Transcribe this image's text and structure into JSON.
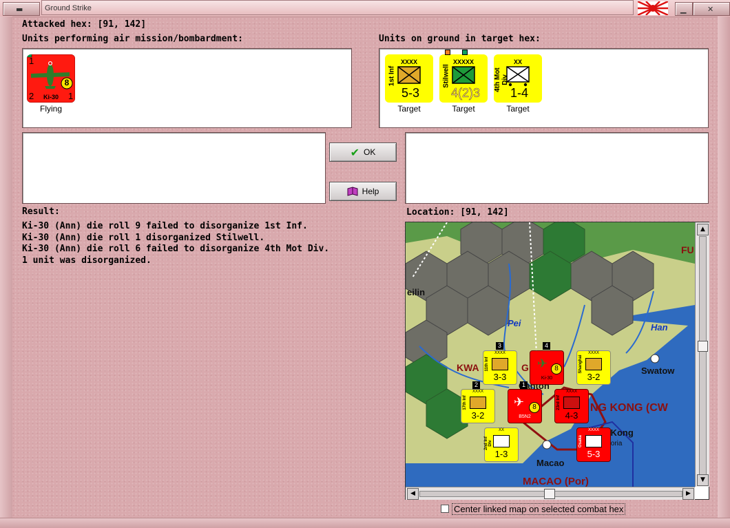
{
  "window": {
    "title": "Ground Strike"
  },
  "attacked_hex": {
    "label": "Attacked hex:",
    "value": "[91, 142]"
  },
  "air_units": {
    "heading": "Units performing air mission/bombardment:",
    "items": [
      {
        "type_label": "Ki-30",
        "top_left": "1",
        "bottom_left": "2",
        "bottom_right": "1",
        "circle": "8",
        "status": "Flying"
      }
    ]
  },
  "ground_units": {
    "heading": "Units on ground in target hex:",
    "items": [
      {
        "name": "1st Inf",
        "size": "XXXX",
        "strength": "5-3",
        "status": "Target",
        "color": "#e0a82a"
      },
      {
        "name": "Stilwell",
        "size": "XXXXX",
        "strength": "4(2)3",
        "status": "Target",
        "color": "#1e9b3a"
      },
      {
        "name": "4th Mot Div",
        "size": "XX",
        "strength": "1-4",
        "status": "Target",
        "color": "#ffffff"
      }
    ]
  },
  "buttons": {
    "ok": "OK",
    "help": "Help"
  },
  "result": {
    "heading": "Result:",
    "lines": [
      "Ki-30 (Ann) die roll 9 failed to disorganize 1st Inf.",
      "Ki-30 (Ann) die roll 1 disorganized Stilwell.",
      "Ki-30 (Ann) die roll 6 failed to disorganize 4th Mot Div.",
      "1 unit was disorganized."
    ]
  },
  "location": {
    "label": "Location:",
    "value": "[91, 142]"
  },
  "map": {
    "labels": {
      "fu": "FU",
      "guilin": "eilin",
      "pei": "Pei",
      "han": "Han",
      "kwangtung": "KWA",
      "kwangtung_tail": "G",
      "swatow": "Swatow",
      "canton": "Canton",
      "hongkong_region": "NG KONG (CW",
      "hongkong": "g Kong",
      "victoria": "ctoria",
      "macao": "Macao",
      "macao_region": "MACAO (Por)"
    },
    "hex_numbers": {
      "n3": "3",
      "n4": "4",
      "n2": "2",
      "n1": "1"
    },
    "counters": [
      {
        "name": "11th Inf",
        "size": "XXXX",
        "strength": "3-3",
        "bg": "#ffff00"
      },
      {
        "name": "Ki-30",
        "size": "",
        "strength": "8",
        "bg": "#ff0000"
      },
      {
        "name": "Shanghai",
        "size": "XXXX",
        "strength": "3-2",
        "bg": "#ffff00"
      },
      {
        "name": "17th Inf",
        "size": "XXXX",
        "strength": "3-2",
        "bg": "#ffff00"
      },
      {
        "name": "B5N2",
        "size": "",
        "strength": "8",
        "bg": "#ff0000"
      },
      {
        "name": "23rd Inf",
        "size": "XXXX",
        "strength": "4-3",
        "bg": "#ff0000"
      },
      {
        "name": "2nd Inf Div",
        "size": "XX",
        "strength": "1-3",
        "bg": "#ffff00"
      },
      {
        "name": "Osaka",
        "size": "XXXX",
        "strength": "5-3",
        "bg": "#ff0000"
      }
    ]
  },
  "options": {
    "center_map_label": "Center linked map on selected combat hex",
    "center_map_checked": false
  },
  "colors": {
    "background": "#d9a9ad",
    "counter_yellow": "#ffff00",
    "counter_red": "#ff0000",
    "sea": "#2f6bbf"
  }
}
